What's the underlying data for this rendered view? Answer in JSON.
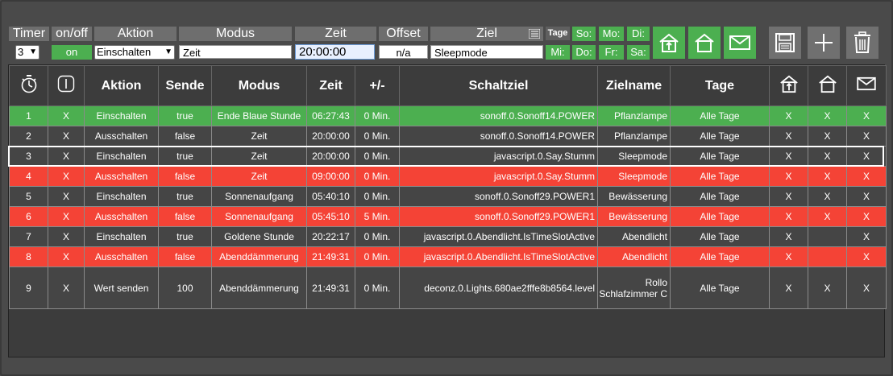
{
  "toolbar": {
    "headers": {
      "timer": "Timer",
      "onoff": "on/off",
      "aktion": "Aktion",
      "modus": "Modus",
      "zeit": "Zeit",
      "offset": "Offset",
      "ziel": "Ziel"
    },
    "timer_select": "3",
    "onoff_button": "on",
    "aktion_select": "Einschalten",
    "modus_value": "Zeit",
    "zeit_value": "20:00:00",
    "offset_value": "n/a",
    "ziel_value": "Sleepmode",
    "tage_label": "Tage",
    "days": [
      "So:",
      "Mo:",
      "Di:",
      "Mi:",
      "Do:",
      "Fr:",
      "Sa:"
    ],
    "icons": {
      "home_in": "home-arrival-icon",
      "home_out": "home-icon",
      "mail": "mail-icon",
      "save": "save-icon",
      "add": "plus-icon",
      "delete": "trash-icon",
      "ziel_picker": "list-picker-icon"
    },
    "colors": {
      "green": "#4caf50",
      "grey": "#707070"
    }
  },
  "table": {
    "headers": {
      "timer": "timer-icon",
      "onoff": "power-icon",
      "aktion": "Aktion",
      "sende": "Sende",
      "modus": "Modus",
      "zeit": "Zeit",
      "offset": "+/-",
      "schaltziel": "Schaltziel",
      "zielname": "Zielname",
      "tage": "Tage",
      "home_in": "home-arrival-icon",
      "home_out": "home-icon",
      "mail": "mail-icon"
    },
    "rows": [
      {
        "nr": "1",
        "onoff": "X",
        "aktion": "Einschalten",
        "sende": "true",
        "modus": "Ende Blaue Stunde",
        "zeit": "06:27:43",
        "offset": "0 Min.",
        "schaltziel": "sonoff.0.Sonoff14.POWER",
        "zielname": "Pflanzlampe",
        "tage": "Alle Tage",
        "h1": "X",
        "h2": "X",
        "mail": "X",
        "style": "green"
      },
      {
        "nr": "2",
        "onoff": "X",
        "aktion": "Ausschalten",
        "sende": "false",
        "modus": "Zeit",
        "zeit": "20:00:00",
        "offset": "0 Min.",
        "schaltziel": "sonoff.0.Sonoff14.POWER",
        "zielname": "Pflanzlampe",
        "tage": "Alle Tage",
        "h1": "X",
        "h2": "X",
        "mail": "X",
        "style": "grey"
      },
      {
        "nr": "3",
        "onoff": "X",
        "aktion": "Einschalten",
        "sende": "true",
        "modus": "Zeit",
        "zeit": "20:00:00",
        "offset": "0 Min.",
        "schaltziel": "javascript.0.Say.Stumm",
        "zielname": "Sleepmode",
        "tage": "Alle Tage",
        "h1": "X",
        "h2": "X",
        "mail": "X",
        "style": "grey"
      },
      {
        "nr": "4",
        "onoff": "X",
        "aktion": "Ausschalten",
        "sende": "false",
        "modus": "Zeit",
        "zeit": "09:00:00",
        "offset": "0 Min.",
        "schaltziel": "javascript.0.Say.Stumm",
        "zielname": "Sleepmode",
        "tage": "Alle Tage",
        "h1": "X",
        "h2": "X",
        "mail": "X",
        "style": "red"
      },
      {
        "nr": "5",
        "onoff": "X",
        "aktion": "Einschalten",
        "sende": "true",
        "modus": "Sonnenaufgang",
        "zeit": "05:40:10",
        "offset": "0 Min.",
        "schaltziel": "sonoff.0.Sonoff29.POWER1",
        "zielname": "Bewässerung",
        "tage": "Alle Tage",
        "h1": "X",
        "h2": "X",
        "mail": "X",
        "style": "grey"
      },
      {
        "nr": "6",
        "onoff": "X",
        "aktion": "Ausschalten",
        "sende": "false",
        "modus": "Sonnenaufgang",
        "zeit": "05:45:10",
        "offset": "5 Min.",
        "schaltziel": "sonoff.0.Sonoff29.POWER1",
        "zielname": "Bewässerung",
        "tage": "Alle Tage",
        "h1": "X",
        "h2": "X",
        "mail": "X",
        "style": "red"
      },
      {
        "nr": "7",
        "onoff": "X",
        "aktion": "Einschalten",
        "sende": "true",
        "modus": "Goldene Stunde",
        "zeit": "20:22:17",
        "offset": "0 Min.",
        "schaltziel": "javascript.0.Abendlicht.IsTimeSlotActive",
        "zielname": "Abendlicht",
        "tage": "Alle Tage",
        "h1": "X",
        "h2": "",
        "mail": "X",
        "style": "grey"
      },
      {
        "nr": "8",
        "onoff": "X",
        "aktion": "Ausschalten",
        "sende": "false",
        "modus": "Abenddämmerung",
        "zeit": "21:49:31",
        "offset": "0 Min.",
        "schaltziel": "javascript.0.Abendlicht.IsTimeSlotActive",
        "zielname": "Abendlicht",
        "tage": "Alle Tage",
        "h1": "X",
        "h2": "",
        "mail": "X",
        "style": "red"
      },
      {
        "nr": "9",
        "onoff": "X",
        "aktion": "Wert senden",
        "sende": "100",
        "modus": "Abenddämmerung",
        "zeit": "21:49:31",
        "offset": "0 Min.",
        "schaltziel": "deconz.0.Lights.680ae2fffe8b8564.level",
        "zielname": "Rollo Schlafzimmer C",
        "tage": "Alle Tage",
        "h1": "X",
        "h2": "X",
        "mail": "X",
        "style": "grey"
      }
    ],
    "selected_row": "3"
  }
}
